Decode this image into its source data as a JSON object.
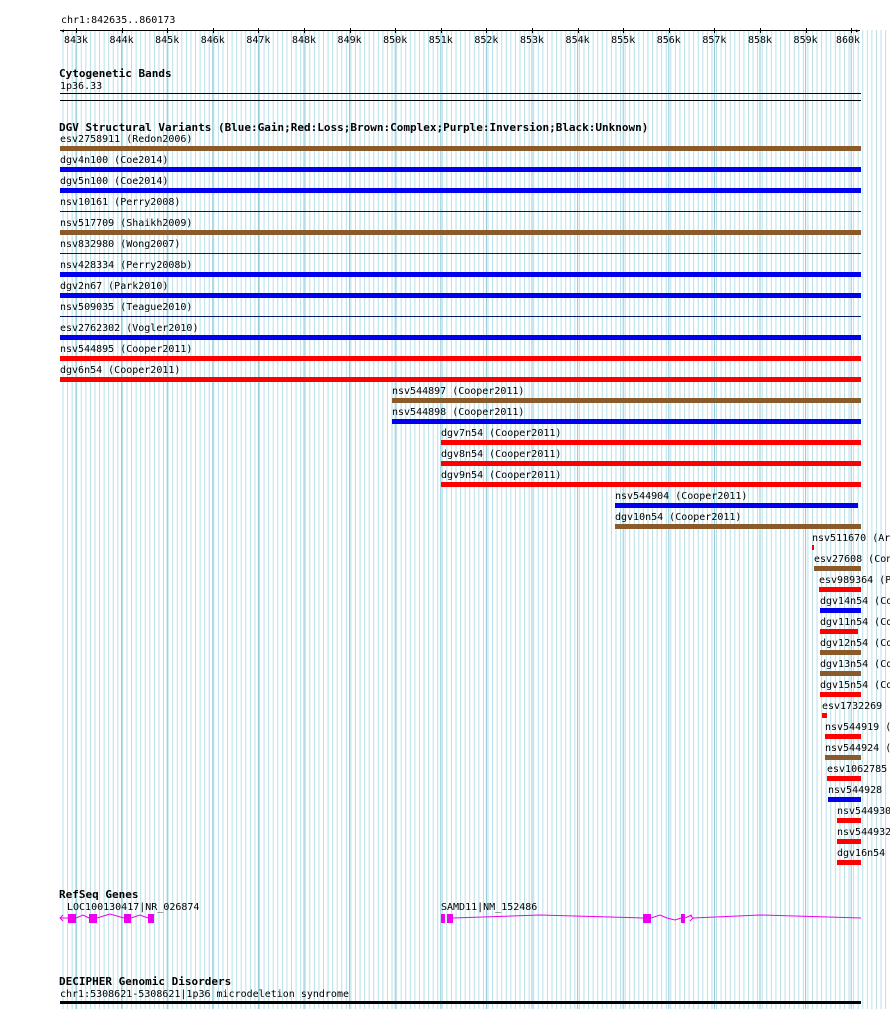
{
  "coords": "chr1:842635..860173",
  "ruler": {
    "ticks": [
      "843k",
      "844k",
      "845k",
      "846k",
      "847k",
      "848k",
      "849k",
      "850k",
      "851k",
      "852k",
      "853k",
      "854k",
      "855k",
      "856k",
      "857k",
      "858k",
      "859k",
      "860k"
    ]
  },
  "cytoband": {
    "title": "Cytogenetic Bands",
    "band": "1p36.33"
  },
  "dgv": {
    "title": "DGV Structural Variants (Blue:Gain;Red:Loss;Brown:Complex;Purple:Inversion;Black:Unknown)",
    "colors": {
      "gain": "#0000ee",
      "loss": "#ff0000",
      "complex": "#8b5a2b"
    },
    "features": [
      {
        "label": "esv2758911 (Redon2006)",
        "type": "complex"
      },
      {
        "label": "dgv4n100 (Coe2014)",
        "type": "gain"
      },
      {
        "label": "dgv5n100 (Coe2014)",
        "type": "gain"
      },
      {
        "label": "nsv10161 (Perry2008)",
        "type": "none"
      },
      {
        "label": "nsv517709 (Shaikh2009)",
        "type": "complex"
      },
      {
        "label": "nsv832980 (Wong2007)",
        "type": "none"
      },
      {
        "label": "nsv428334 (Perry2008b)",
        "type": "gain"
      },
      {
        "label": "dgv2n67 (Park2010)",
        "type": "gain"
      },
      {
        "label": "nsv509035 (Teague2010)",
        "type": "none"
      },
      {
        "label": "esv2762302 (Vogler2010)",
        "type": "gain"
      },
      {
        "label": "nsv544895 (Cooper2011)",
        "type": "loss"
      },
      {
        "label": "dgv6n54 (Cooper2011)",
        "type": "loss"
      },
      {
        "label": "nsv544897 (Cooper2011)",
        "type": "complex"
      },
      {
        "label": "nsv544898 (Cooper2011)",
        "type": "gain"
      },
      {
        "label": "dgv7n54 (Cooper2011)",
        "type": "loss"
      },
      {
        "label": "dgv8n54 (Cooper2011)",
        "type": "loss"
      },
      {
        "label": "dgv9n54 (Cooper2011)",
        "type": "loss"
      },
      {
        "label": "nsv544904 (Cooper2011)",
        "type": "gain"
      },
      {
        "label": "dgv10n54 (Cooper2011)",
        "type": "complex"
      },
      {
        "label": "nsv511670 (Ar",
        "type": "loss"
      },
      {
        "label": "esv27608 (Con",
        "type": "complex"
      },
      {
        "label": "esv989364 (P",
        "type": "loss"
      },
      {
        "label": "dgv14n54 (Co",
        "type": "gain"
      },
      {
        "label": "dgv11n54 (Co",
        "type": "loss"
      },
      {
        "label": "dgv12n54 (Co",
        "type": "complex"
      },
      {
        "label": "dgv13n54 (Co",
        "type": "complex"
      },
      {
        "label": "dgv15n54 (Co",
        "type": "loss"
      },
      {
        "label": "esv1732269 (",
        "type": "loss"
      },
      {
        "label": "nsv544919 (",
        "type": "loss"
      },
      {
        "label": "nsv544924 (",
        "type": "complex"
      },
      {
        "label": "esv1062785",
        "type": "loss"
      },
      {
        "label": "nsv544928 (",
        "type": "gain"
      },
      {
        "label": "nsv544930",
        "type": "loss"
      },
      {
        "label": "nsv544932",
        "type": "loss"
      },
      {
        "label": "dgv16n54",
        "type": "loss"
      }
    ]
  },
  "refseq": {
    "title": "RefSeq Genes",
    "exon_color": "#ee00ee",
    "genes": [
      {
        "label": "LOC100130417|NR_026874"
      },
      {
        "label": "SAMD11|NM_152486"
      }
    ]
  },
  "decipher": {
    "title": "DECIPHER Genomic Disorders",
    "feature": "chr1:5308621-5308621|1p36 microdeletion syndrome"
  }
}
